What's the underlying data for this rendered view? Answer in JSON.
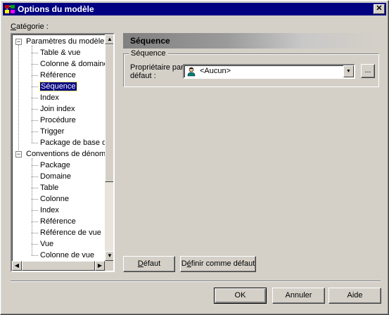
{
  "window": {
    "title": "Options du modèle",
    "close_label": "✕"
  },
  "category": {
    "label_prefix": "C",
    "label_rest": "atégorie :"
  },
  "tree": {
    "items": [
      {
        "label": "Paramètres du modèle",
        "level": 0,
        "toggle": "−"
      },
      {
        "label": "Table & vue",
        "level": 1
      },
      {
        "label": "Colonne & domaine",
        "level": 1
      },
      {
        "label": "Référence",
        "level": 1
      },
      {
        "label": "Séquence",
        "level": 1,
        "selected": true
      },
      {
        "label": "Index",
        "level": 1
      },
      {
        "label": "Join index",
        "level": 1
      },
      {
        "label": "Procédure",
        "level": 1
      },
      {
        "label": "Trigger",
        "level": 1
      },
      {
        "label": "Package de base de",
        "level": 1
      },
      {
        "label": "Conventions de dénomi",
        "level": 0,
        "toggle": "−"
      },
      {
        "label": "Package",
        "level": 1
      },
      {
        "label": "Domaine",
        "level": 1
      },
      {
        "label": "Table",
        "level": 1
      },
      {
        "label": "Colonne",
        "level": 1
      },
      {
        "label": "Index",
        "level": 1
      },
      {
        "label": "Référence",
        "level": 1
      },
      {
        "label": "Référence de vue",
        "level": 1
      },
      {
        "label": "Vue",
        "level": 1
      },
      {
        "label": "Colonne de vue",
        "level": 1
      }
    ]
  },
  "panel": {
    "header": "Séquence",
    "group_title": "Séquence",
    "owner_label_line1": "Propriétaire par",
    "owner_label_line2": "défaut :",
    "owner_value": "<Aucun>",
    "ellipsis": "...",
    "default_button_prefix": "D",
    "default_button_rest": "éfaut",
    "set_default_prefix": "D",
    "set_default_mid": "é",
    "set_default_rest": "finir comme défaut"
  },
  "footer": {
    "ok": "OK",
    "cancel": "Annuler",
    "help": "Aide"
  },
  "colors": {
    "titlebar": "#000080",
    "face": "#d4d0c8",
    "selection": "#000080"
  },
  "icons": {
    "app": "model-options-icon",
    "owner": "user-icon"
  }
}
